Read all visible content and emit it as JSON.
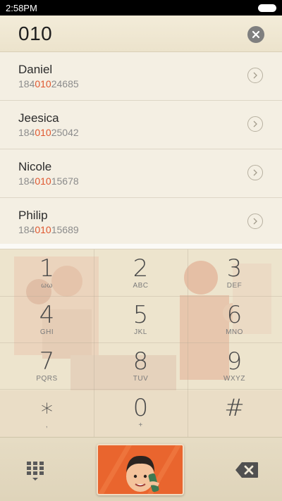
{
  "status_bar": {
    "time": "2:58PM"
  },
  "dialer": {
    "number": "010"
  },
  "results": [
    {
      "name": "Daniel",
      "number_prefix": "184",
      "number_match": "010",
      "number_suffix": "24685"
    },
    {
      "name": "Jeesica",
      "number_prefix": "184",
      "number_match": "010",
      "number_suffix": "25042"
    },
    {
      "name": "Nicole",
      "number_prefix": "184",
      "number_match": "010",
      "number_suffix": "15678"
    },
    {
      "name": "Philip",
      "number_prefix": "184",
      "number_match": "010",
      "number_suffix": "15689"
    }
  ],
  "keypad": [
    {
      "digit": "1",
      "letters": "ωω"
    },
    {
      "digit": "2",
      "letters": "ABC"
    },
    {
      "digit": "3",
      "letters": "DEF"
    },
    {
      "digit": "4",
      "letters": "GHI"
    },
    {
      "digit": "5",
      "letters": "JKL"
    },
    {
      "digit": "6",
      "letters": "MNO"
    },
    {
      "digit": "7",
      "letters": "PQRS"
    },
    {
      "digit": "8",
      "letters": "TUV"
    },
    {
      "digit": "9",
      "letters": "WXYZ"
    },
    {
      "digit": "∗",
      "letters": ","
    },
    {
      "digit": "0",
      "letters": "+"
    },
    {
      "digit": "#",
      "letters": ""
    }
  ],
  "colors": {
    "highlight": "#e0572f",
    "call_button": "#e9652e",
    "background": "#efe8d6"
  },
  "icons": {
    "clear": "close-icon",
    "detail": "chevron-right-icon",
    "dialpad_toggle": "dialpad-icon",
    "call": "call-illustration-icon",
    "backspace": "backspace-icon"
  }
}
